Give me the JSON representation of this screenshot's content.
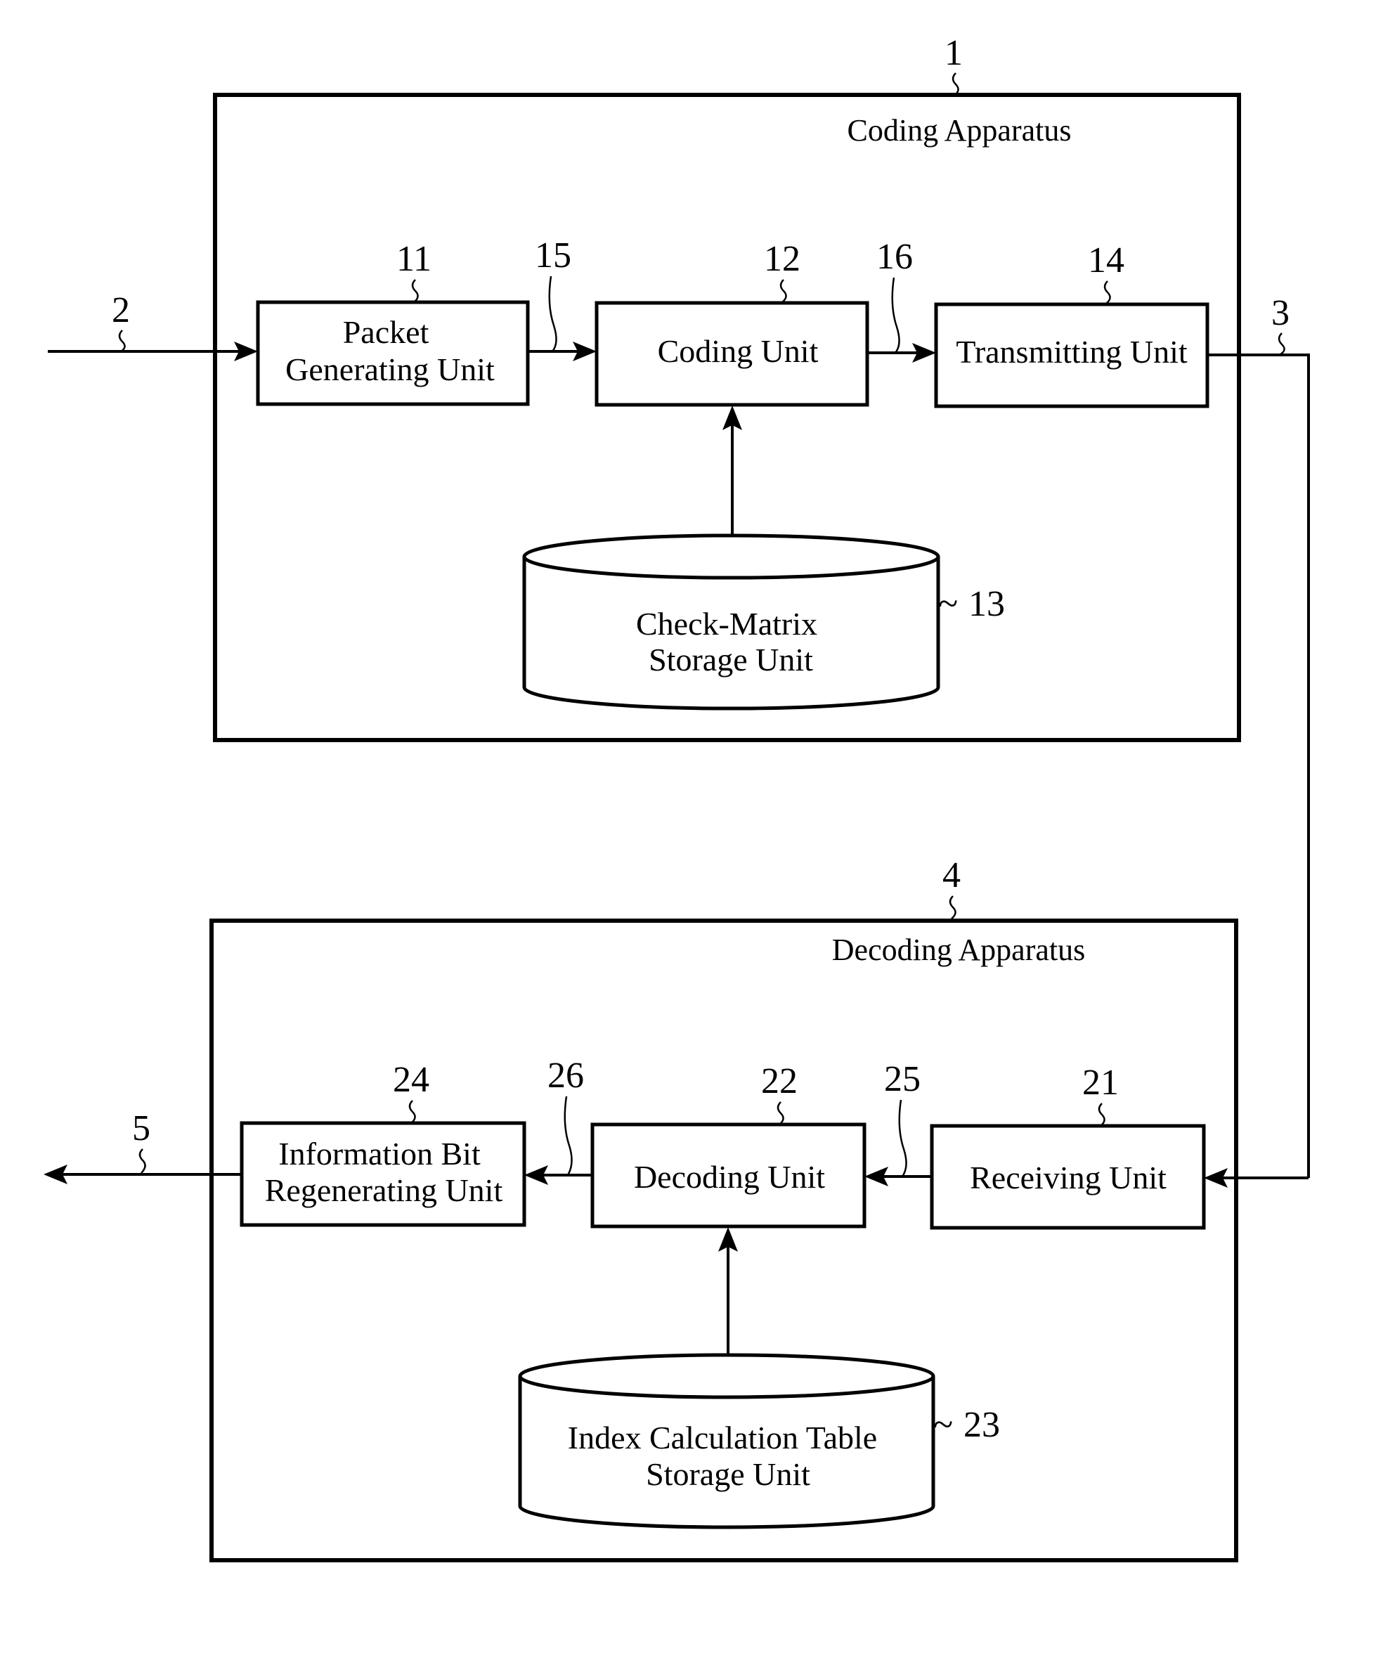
{
  "coding_apparatus": {
    "ref": "1",
    "title": "Coding Apparatus",
    "input_ref": "2",
    "output_ref": "3",
    "units": {
      "packet": {
        "ref": "11",
        "line1": "Packet",
        "line2": "Generating Unit"
      },
      "coding": {
        "ref": "12",
        "label": "Coding Unit"
      },
      "storage": {
        "ref": "13",
        "line1": "Check-Matrix",
        "line2": "Storage Unit"
      },
      "transmit": {
        "ref": "14",
        "label": "Transmitting Unit"
      }
    },
    "signals": {
      "s15": "15",
      "s16": "16"
    }
  },
  "decoding_apparatus": {
    "ref": "4",
    "title": "Decoding Apparatus",
    "output_ref": "5",
    "units": {
      "receive": {
        "ref": "21",
        "label": "Receiving Unit"
      },
      "decode": {
        "ref": "22",
        "label": "Decoding Unit"
      },
      "storage": {
        "ref": "23",
        "line1": "Index Calculation Table",
        "line2": "Storage Unit"
      },
      "regen": {
        "ref": "24",
        "line1": "Information Bit",
        "line2": "Regenerating Unit"
      }
    },
    "signals": {
      "s25": "25",
      "s26": "26"
    }
  },
  "symbols": {
    "tilde": "~"
  }
}
